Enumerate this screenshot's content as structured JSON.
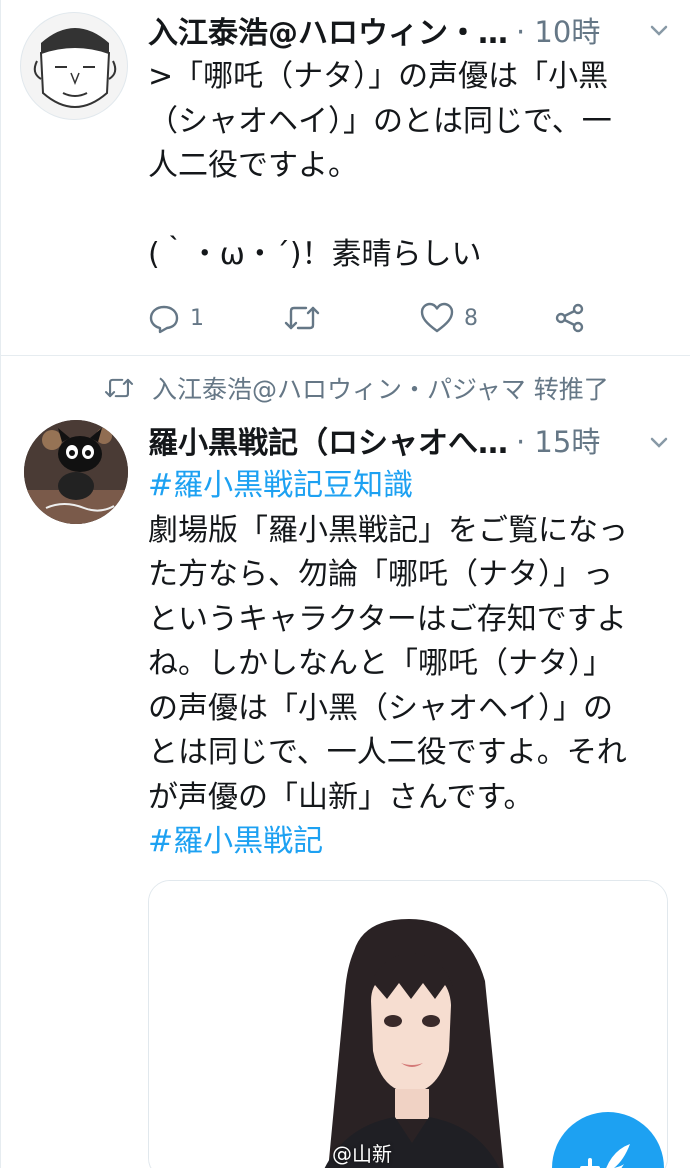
{
  "tweets": [
    {
      "author": "入江泰浩@ハロウィン・…",
      "time": "· 10時",
      "text_lines": [
        ">「哪吒（ナタ）」の声優は「小黑",
        "（シャオヘイ）」のとは同じで、一",
        "人二役ですよ。",
        "",
        "(｀・ω・´)！素晴らしい"
      ],
      "actions": {
        "reply_count": "1",
        "retweet_count": "",
        "like_count": "8"
      }
    },
    {
      "retweet_context": "入江泰浩@ハロウィン・パジャマ 转推了",
      "author": "羅小黒戦記（ロシャオへ…",
      "time": "· 15時",
      "hashtag_top": "#羅小黒戦記豆知識",
      "text_lines": [
        "劇場版「羅小黒戦記」をご覧になっ",
        "た方なら、勿論「哪吒（ナタ）」っ",
        "というキャラクターはご存知ですよ",
        "ね。しかしなんと「哪吒（ナタ）」",
        "の声優は「小黑（シャオヘイ）」の",
        "とは同じで、一人二役ですよ。それ",
        "が声優の「山新」さんです。"
      ],
      "hashtag_bottom": "#羅小黒戦記",
      "media_watermark": "@山新"
    }
  ],
  "colors": {
    "accent": "#1da1f2",
    "secondary_text": "#657786",
    "primary_text": "#14171a",
    "divider": "#e6ecf0"
  },
  "icons": {
    "reply": "reply-icon",
    "retweet": "retweet-icon",
    "like": "heart-icon",
    "share": "share-icon",
    "chevron": "chevron-down-icon",
    "compose": "compose-tweet-icon"
  }
}
